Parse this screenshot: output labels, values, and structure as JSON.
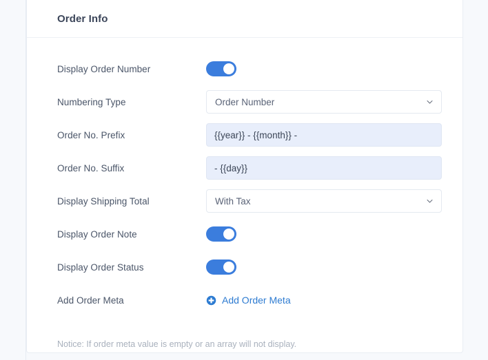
{
  "card": {
    "title": "Order Info"
  },
  "rows": [
    {
      "label": "Display Order Number",
      "type": "toggle",
      "value": "on"
    },
    {
      "label": "Numbering Type",
      "type": "select",
      "value": "Order Number"
    },
    {
      "label": "Order No. Prefix",
      "type": "text",
      "value": "{{year}} - {{month}} -"
    },
    {
      "label": "Order No. Suffix",
      "type": "text",
      "value": "- {{day}}"
    },
    {
      "label": "Display Shipping Total",
      "type": "select",
      "value": "With Tax"
    },
    {
      "label": "Display Order Note",
      "type": "toggle",
      "value": "on"
    },
    {
      "label": "Display Order Status",
      "type": "toggle",
      "value": "on"
    },
    {
      "label": "Add Order Meta",
      "type": "link",
      "value": "Add Order Meta"
    }
  ],
  "notice": "Notice: If order meta value is empty or an array will not display.",
  "icons": {
    "chevron": "chevron-down-icon",
    "plus": "plus-circle-icon"
  },
  "colors": {
    "accent": "#3b7ddd",
    "link": "#2d7bd1",
    "input_autofill_bg": "#e8eefb",
    "label_text": "#4a5568",
    "notice_text": "#a9b1bd",
    "page_bg": "#f7f9fc",
    "card_bg": "#ffffff"
  }
}
